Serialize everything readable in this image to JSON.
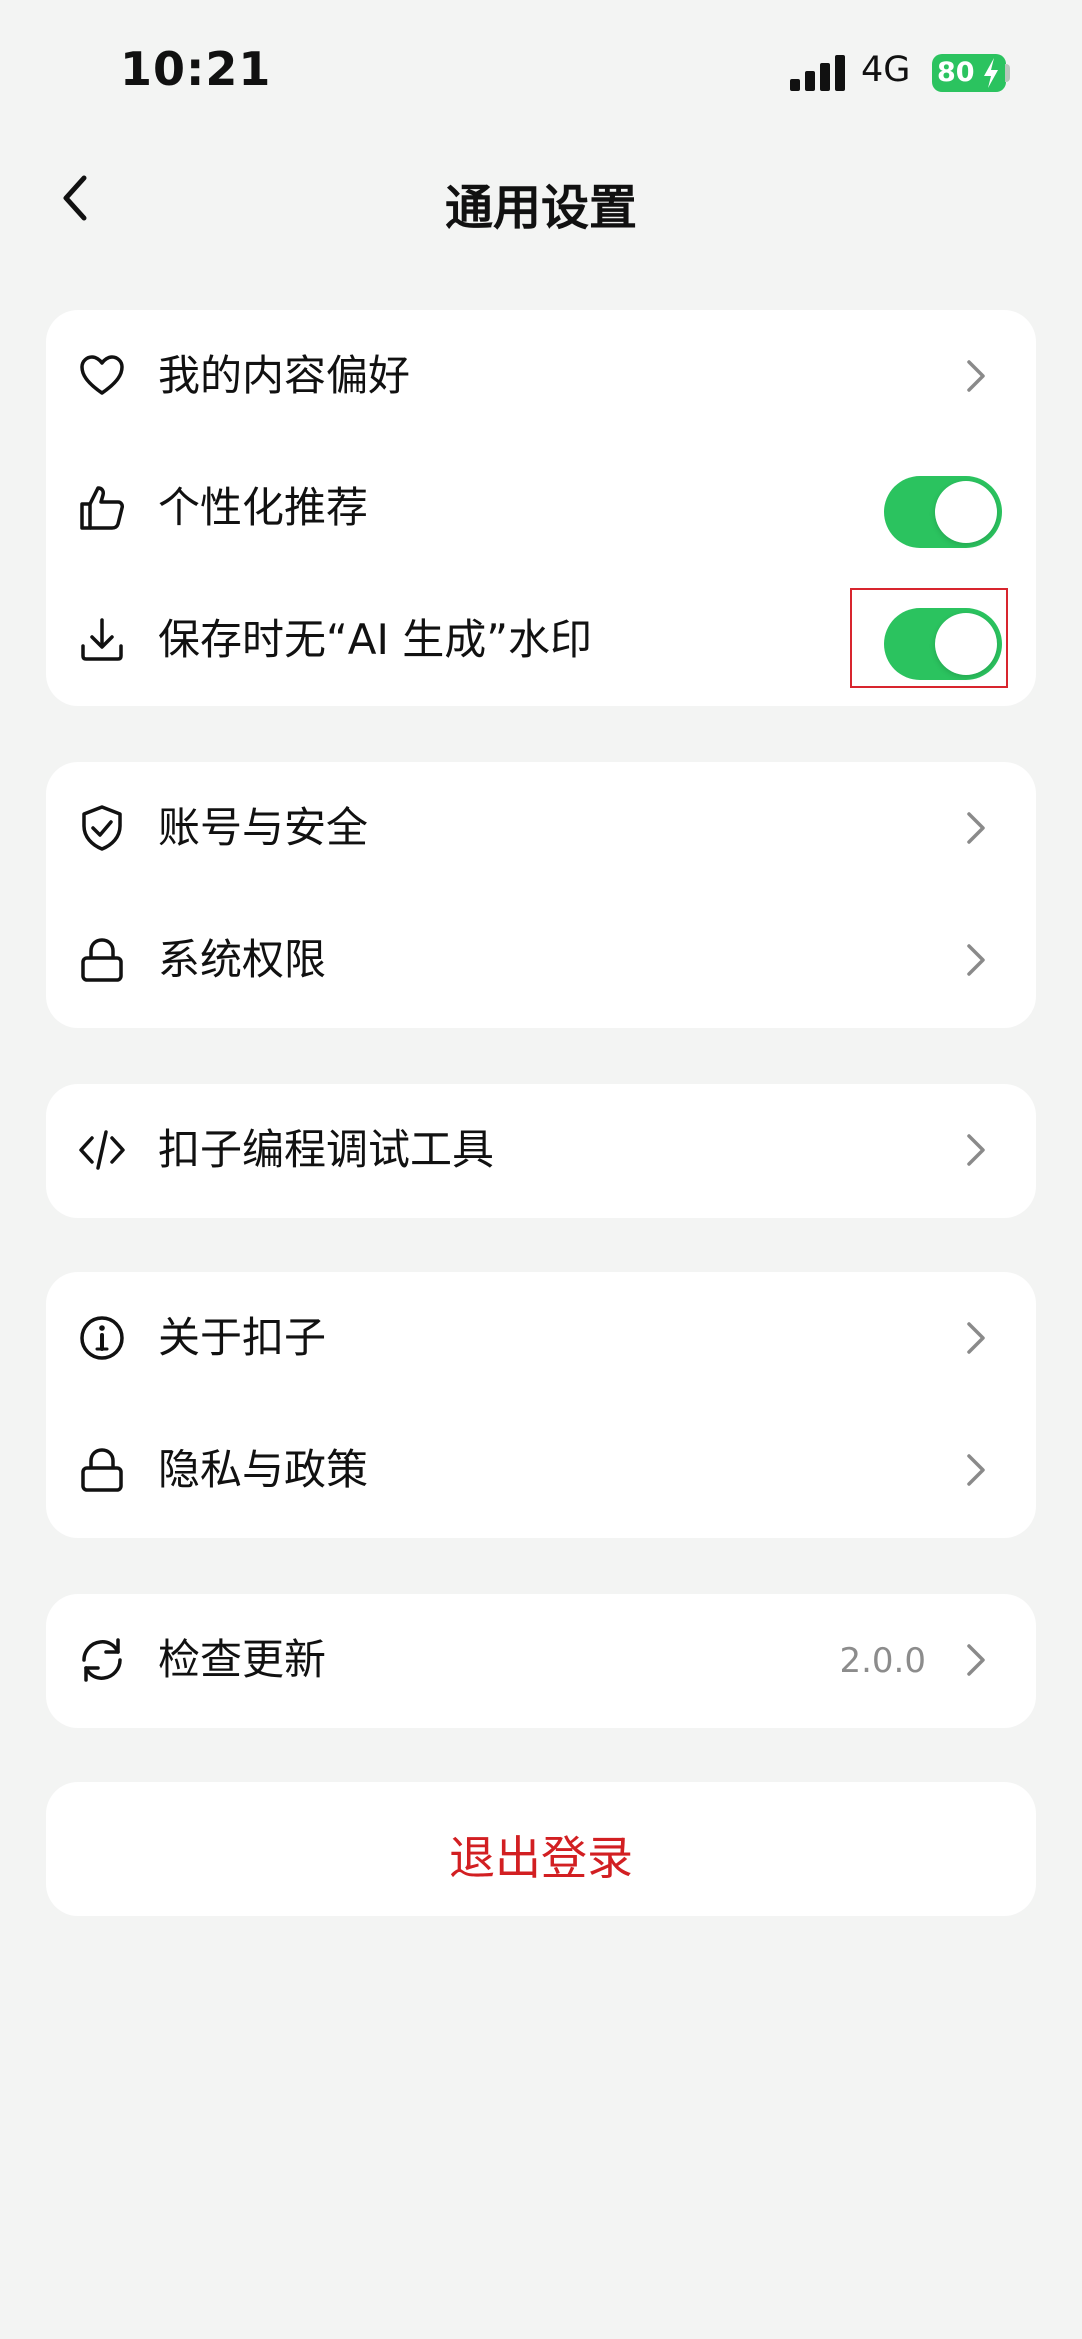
{
  "status_bar": {
    "time": "10:21",
    "network": "4G",
    "battery": "80"
  },
  "nav": {
    "title": "通用设置"
  },
  "groups": [
    {
      "items": [
        {
          "label": "我的内容偏好",
          "icon": "heart-icon",
          "control": "chevron"
        },
        {
          "label": "个性化推荐",
          "icon": "thumbs-up-icon",
          "control": "toggle",
          "on": true
        },
        {
          "label": "保存时无“AI 生成”水印",
          "icon": "download-icon",
          "control": "toggle",
          "on": true
        }
      ]
    },
    {
      "items": [
        {
          "label": "账号与安全",
          "icon": "shield-check-icon",
          "control": "chevron"
        },
        {
          "label": "系统权限",
          "icon": "lock-icon",
          "control": "chevron"
        }
      ]
    },
    {
      "items": [
        {
          "label": "扣子编程调试工具",
          "icon": "code-icon",
          "control": "chevron"
        }
      ]
    },
    {
      "items": [
        {
          "label": "关于扣子",
          "icon": "info-icon",
          "control": "chevron"
        },
        {
          "label": "隐私与政策",
          "icon": "lock-icon",
          "control": "chevron"
        }
      ]
    },
    {
      "items": [
        {
          "label": "检查更新",
          "icon": "refresh-icon",
          "control": "chevron",
          "value": "2.0.0"
        }
      ]
    }
  ],
  "logout": {
    "label": "退出登录"
  },
  "colors": {
    "accent_green": "#2bc35f",
    "danger_red": "#d21f22",
    "background": "#f3f4f3"
  }
}
